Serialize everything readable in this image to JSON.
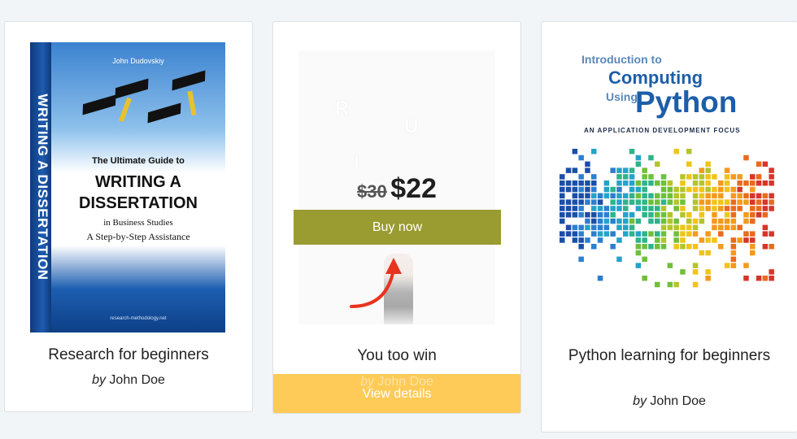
{
  "cards": [
    {
      "title": "Research for beginners",
      "by": "by",
      "author": "John Doe",
      "cover": {
        "author": "John Dudovskiy",
        "spine": "WRITING A DISSERTATION",
        "line1": "The Ultimate Guide to",
        "line2": "WRITING A",
        "line3": "DISSERTATION",
        "line4": "in Business Studies",
        "line5": "A Step-by-Step Assistance",
        "footer": "research-methodology.net"
      }
    },
    {
      "title": "You too win",
      "by": "by",
      "author": "John Doe",
      "old_price": "$30",
      "new_price": "$22",
      "buy_label": "Buy now",
      "view_label": "View details",
      "cover_letters": [
        "R",
        "U",
        "I"
      ]
    },
    {
      "title": "Python learning for beginners",
      "by": "by",
      "author": "John Doe",
      "cover": {
        "line1": "Introduction to",
        "line2": "Computing",
        "line3": "Using",
        "line4": "Python",
        "subtitle": "AN APPLICATION DEVELOPMENT FOCUS"
      }
    }
  ],
  "colors": {
    "buy_button": "#9a9b31",
    "view_button": "#ffcb58",
    "arrow": "#e8331f"
  },
  "icons": [
    "red-arrow-icon"
  ]
}
